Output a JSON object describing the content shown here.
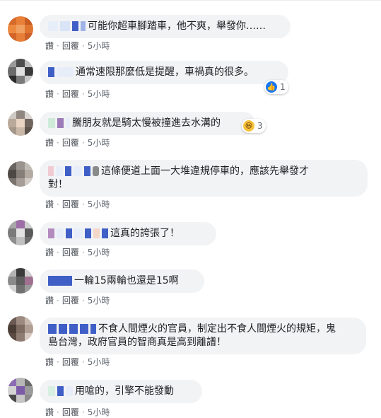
{
  "actions": {
    "like": "讚",
    "reply": "回覆",
    "sep": "·"
  },
  "comments": [
    {
      "text": "可能你超車腳踏車，他不爽，舉發你……",
      "time": "5小時"
    },
    {
      "text": "通常速限那麼低是提醒，車禍真的很多。",
      "time": "5小時",
      "reaction_count": "1"
    },
    {
      "text": "友就是騎太慢被撞進去水溝的",
      "prefix": "騰朋",
      "time": "5小時",
      "reaction_count": "3"
    },
    {
      "text_line1": "這條便道上面一大堆違規停車的，應該先舉發才",
      "text_line2": "對！",
      "time": "5小時"
    },
    {
      "text": "這真的誇張了！",
      "time": "5小時"
    },
    {
      "text": "一輪15兩輪也還是15啊",
      "time": "5小時"
    },
    {
      "text_line1": "不食人間煙火的官員，制定出不食人間煙火的規矩，鬼",
      "text_line2": "島台灣，政府官員的智商真是高到離譜！",
      "time": "5小時"
    },
    {
      "text": "用嗆的，引擎不能發動",
      "time": "5小時"
    }
  ],
  "colors": {
    "bubble": "#f2f3f5",
    "like": "#1877f2",
    "haha": "#f7c23b",
    "action": "#4b4f56"
  }
}
